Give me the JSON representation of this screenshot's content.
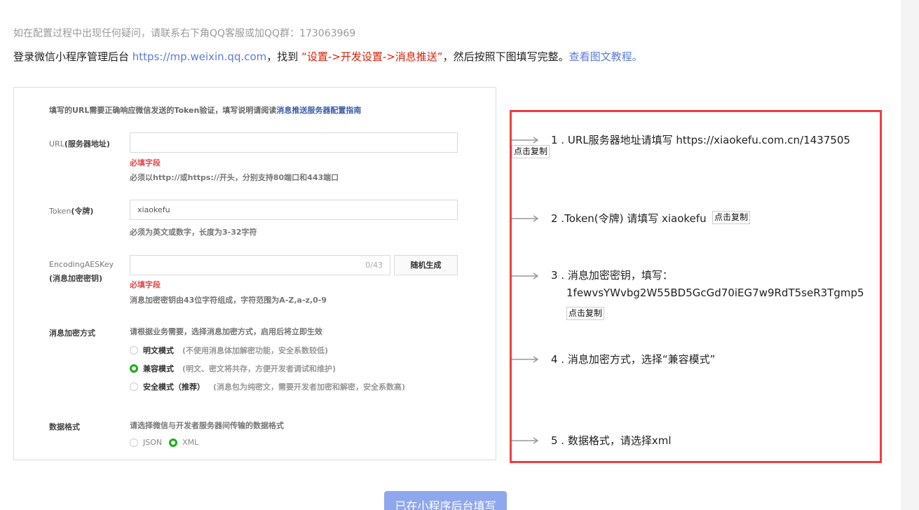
{
  "header": {
    "hint": "如在配置过程中出现任何疑问，请联系右下角QQ客服或加QQ群：173063969",
    "instr_prefix": "登录微信小程序管理后台 ",
    "instr_link": "https://mp.weixin.qq.com",
    "instr_mid1": "，找到 ",
    "instr_path": "“设置->开发设置->消息推送”",
    "instr_mid2": "，然后按照下图填写完整。",
    "instr_tutorial": "查看图文教程。"
  },
  "panel": {
    "note_text": "填写的URL需要正确响应微信发送的Token验证，填写说明请阅读",
    "note_link": "消息推送服务器配置指南",
    "url": {
      "label_en": "URL",
      "label_cn": "(服务器地址)",
      "value": "",
      "error": "必填字段",
      "help": "必须以http://或https://开头，分别支持80端口和443端口"
    },
    "token": {
      "label_en": "Token",
      "label_cn": "(令牌)",
      "value": "xiaokefu",
      "help": "必须为英文或数字，长度为3-32字符"
    },
    "aes": {
      "label_en": "EncodingAESKey",
      "label_cn": "(消息加密密钥)",
      "value": "",
      "counter": "0/43",
      "gen_button": "随机生成",
      "error": "必填字段",
      "help": "消息加密密钥由43位字符组成，字符范围为A-Z,a-z,0-9"
    },
    "encrypt": {
      "label": "消息加密方式",
      "help": "请根据业务需要，选择消息加密方式，启用后将立即生效",
      "options": [
        {
          "name": "明文模式",
          "desc": "(不使用消息体加解密功能，安全系数较低)",
          "selected": false
        },
        {
          "name": "兼容模式",
          "desc": "(明文、密文将共存，方便开发者调试和维护)",
          "selected": true
        },
        {
          "name": "安全模式（推荐）",
          "desc": "(消息包为纯密文，需要开发者加密和解密，安全系数高)",
          "selected": false
        }
      ]
    },
    "format": {
      "label": "数据格式",
      "help": "请选择微信与开发者服务器间传输的数据格式",
      "options": [
        {
          "name": "JSON",
          "selected": false
        },
        {
          "name": "XML",
          "selected": true
        }
      ]
    }
  },
  "steps": {
    "s1": "1 . URL服务器地址请填写 https://xiaokefu.com.cn/1437505",
    "s2": "2 .Token(令牌) 请填写 xiaokefu",
    "s3a": "3 . 消息加密密钥，填写：",
    "s3b": "1fewvsYWvbg2W55BD5GcGd70iEG7w9RdT5seR3Tgmp5",
    "s4": "4 . 消息加密方式，选择“兼容模式”",
    "s5": "5 . 数据格式，请选择xml",
    "copy_label": "点击复制"
  },
  "submit_label": "已在小程序后台填写",
  "colors": {
    "accent": "#5a7bd8",
    "highlight_border": "#ef3e3e",
    "selected_radio": "#1aad19",
    "submit_bg": "#8fa7ec"
  }
}
